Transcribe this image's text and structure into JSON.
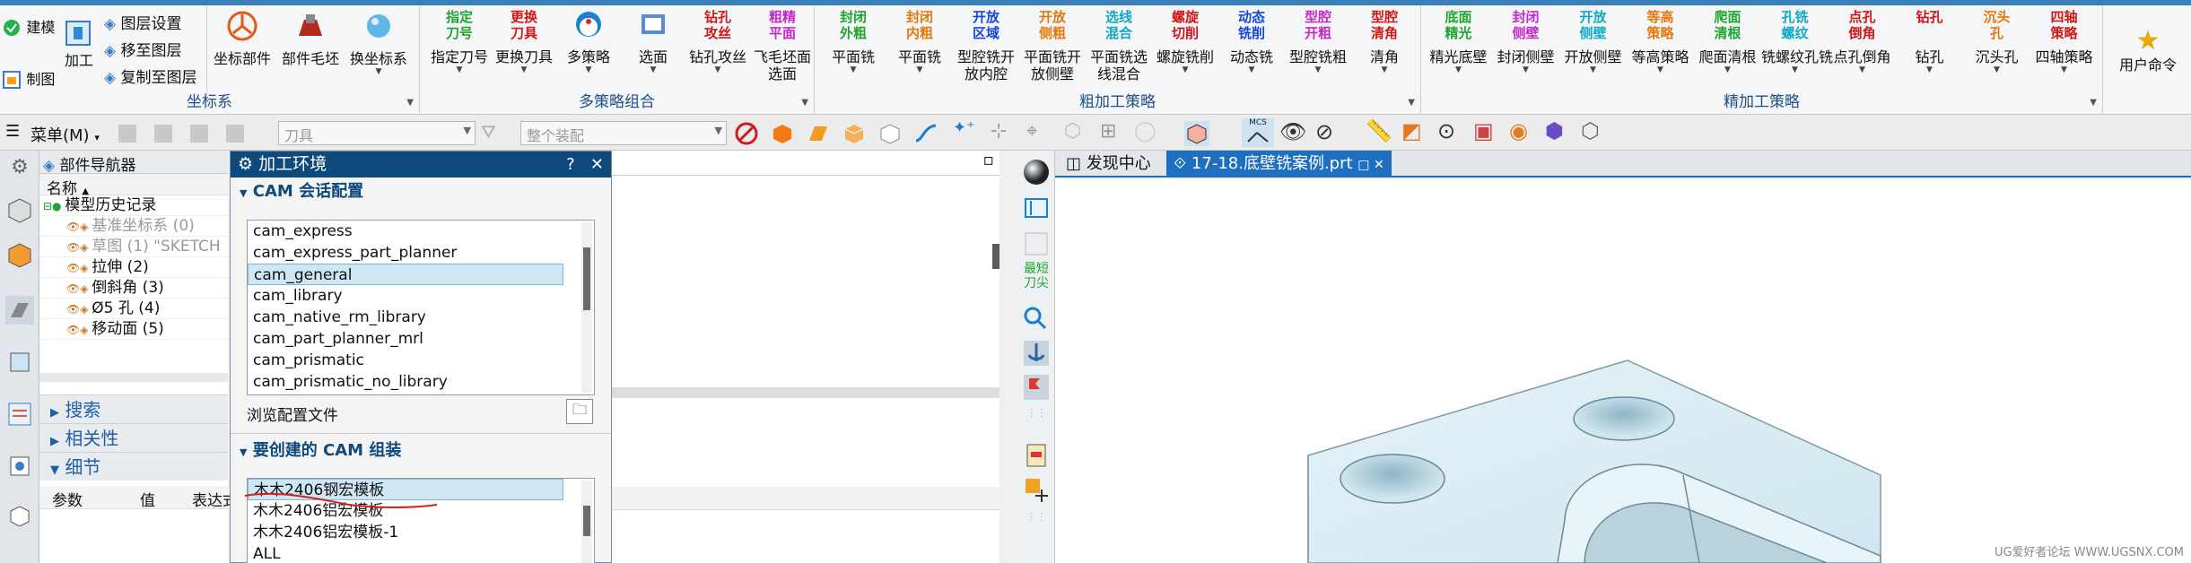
{
  "ribbon": {
    "coord_group": {
      "label": "坐标系",
      "left_items": [
        {
          "label": "建模"
        },
        {
          "label": "制图"
        }
      ],
      "jiagong": "加工",
      "layer_items": [
        "图层设置",
        "移至图层",
        "复制至图层"
      ],
      "tools": [
        "坐标部件",
        "部件毛坯",
        "换坐标系"
      ]
    },
    "multi_group": {
      "label": "多策略组合",
      "tools": [
        {
          "top": [
            "指定",
            "刀号"
          ],
          "color": "green",
          "label": "指定刀号"
        },
        {
          "top": [
            "更换",
            "刀具"
          ],
          "color": "red",
          "label": "更换刀具"
        },
        {
          "top": [],
          "color": "blue",
          "label": "多策略"
        },
        {
          "top": [],
          "color": "dark",
          "label": "选面"
        },
        {
          "top": [
            "钻孔",
            "攻丝"
          ],
          "color": "red",
          "label": "钻孔攻丝"
        },
        {
          "top": [
            "粗精",
            "平面"
          ],
          "color": "magenta",
          "label": "飞毛坯面",
          "label2": "选面"
        }
      ]
    },
    "rough_group": {
      "label": "粗加工策略",
      "tools": [
        {
          "top": [
            "封闭",
            "外粗"
          ],
          "color": "green",
          "label": "平面铣"
        },
        {
          "top": [
            "封闭",
            "内粗"
          ],
          "color": "orange",
          "label": "平面铣"
        },
        {
          "top": [
            "开放",
            "区域"
          ],
          "color": "blue",
          "label": "型腔铣开",
          "label2": "放内腔"
        },
        {
          "top": [
            "开放",
            "侧粗"
          ],
          "color": "orange",
          "label": "平面铣开",
          "label2": "放侧壁"
        },
        {
          "top": [
            "选线",
            "混合"
          ],
          "color": "cyan",
          "label": "平面铣选",
          "label2": "线混合"
        },
        {
          "top": [
            "螺旋",
            "切削"
          ],
          "color": "red",
          "label": "螺旋铣削"
        },
        {
          "top": [
            "动态",
            "铣削"
          ],
          "color": "blue",
          "label": "动态铣"
        },
        {
          "top": [
            "型腔",
            "开粗"
          ],
          "color": "magenta",
          "label": "型腔铣粗"
        },
        {
          "top": [
            "型腔",
            "清角"
          ],
          "color": "red",
          "label": "清角"
        }
      ]
    },
    "finish_group": {
      "label": "精加工策略",
      "tools": [
        {
          "top": [
            "底面",
            "精光"
          ],
          "color": "green",
          "label": "精光底壁"
        },
        {
          "top": [
            "封闭",
            "侧壁"
          ],
          "color": "magenta",
          "label": "封闭侧壁"
        },
        {
          "top": [
            "开放",
            "侧壁"
          ],
          "color": "cyan",
          "label": "开放侧壁"
        },
        {
          "top": [
            "等高",
            "策略"
          ],
          "color": "orange",
          "label": "等高策略"
        },
        {
          "top": [
            "爬面",
            "清根"
          ],
          "color": "green",
          "label": "爬面清根"
        },
        {
          "top": [
            "孔铣",
            "螺纹"
          ],
          "color": "cyan",
          "label": "铣螺纹孔铣"
        },
        {
          "top": [
            "点孔",
            "倒角"
          ],
          "color": "red",
          "label": "点孔倒角"
        },
        {
          "top": [
            "钻孔"
          ],
          "color": "red",
          "label": "钻孔"
        },
        {
          "top": [
            "沉头",
            "孔"
          ],
          "color": "orange",
          "label": "沉头孔"
        },
        {
          "top": [
            "四轴",
            "策略"
          ],
          "color": "red",
          "label": "四轴策略"
        }
      ]
    },
    "user_cmd": "用户命令"
  },
  "quickbar": {
    "menu_label": "菜单(M)",
    "tool_combo": "刀具",
    "assembly_combo": "整个装配",
    "mcs_label": "MCS"
  },
  "navigator": {
    "title": "部件导航器",
    "col_name": "名称",
    "tree": [
      {
        "label": "模型历史记录",
        "indent": 0,
        "dim": false
      },
      {
        "label": "基准坐标系 (0)",
        "indent": 1,
        "dim": true
      },
      {
        "label": "草图 (1) \"SKETCH",
        "indent": 1,
        "dim": true
      },
      {
        "label": "拉伸 (2)",
        "indent": 1,
        "dim": false
      },
      {
        "label": "倒斜角 (3)",
        "indent": 1,
        "dim": false
      },
      {
        "label": "Ø5 孔 (4)",
        "indent": 1,
        "dim": false
      },
      {
        "label": "移动面 (5)",
        "indent": 1,
        "dim": false
      }
    ],
    "sections": [
      "搜索",
      "相关性",
      "细节"
    ],
    "detail_cols": [
      "参数",
      "值",
      "表达式"
    ]
  },
  "dialog": {
    "title": "加工环境",
    "help": "?",
    "close": "✕",
    "sec1": "CAM 会话配置",
    "configs": [
      "cam_express",
      "cam_express_part_planner",
      "cam_general",
      "cam_library",
      "cam_native_rm_library",
      "cam_part_planner_mrl",
      "cam_prismatic",
      "cam_prismatic_no_library"
    ],
    "selected_config": 2,
    "browse_label": "浏览配置文件",
    "sec2": "要创建的 CAM 组装",
    "setups": [
      "木木2406钢宏模板",
      "木木2406铝宏模板",
      "木木2406铝宏模板-1",
      "ALL"
    ],
    "selected_setup": 0
  },
  "toolstrip": {
    "shortest_tool": [
      "最短",
      "刀尖"
    ]
  },
  "tabs": [
    {
      "label": "发现中心",
      "active": false
    },
    {
      "label": "17-18.底壁铣案例.prt",
      "active": true,
      "marks": "□ ✕"
    }
  ],
  "watermark": "UG爱好者论坛 WWW.UGSNX.COM",
  "colors": {
    "green": "#1ea52c",
    "red": "#d01616",
    "orange": "#e3780e",
    "blue": "#1546d8",
    "magenta": "#c42ac9",
    "cyan": "#0fa9c5",
    "dark": "#222",
    "title_blue": "#0e4a7c",
    "tab_blue": "#1e6fbf"
  }
}
